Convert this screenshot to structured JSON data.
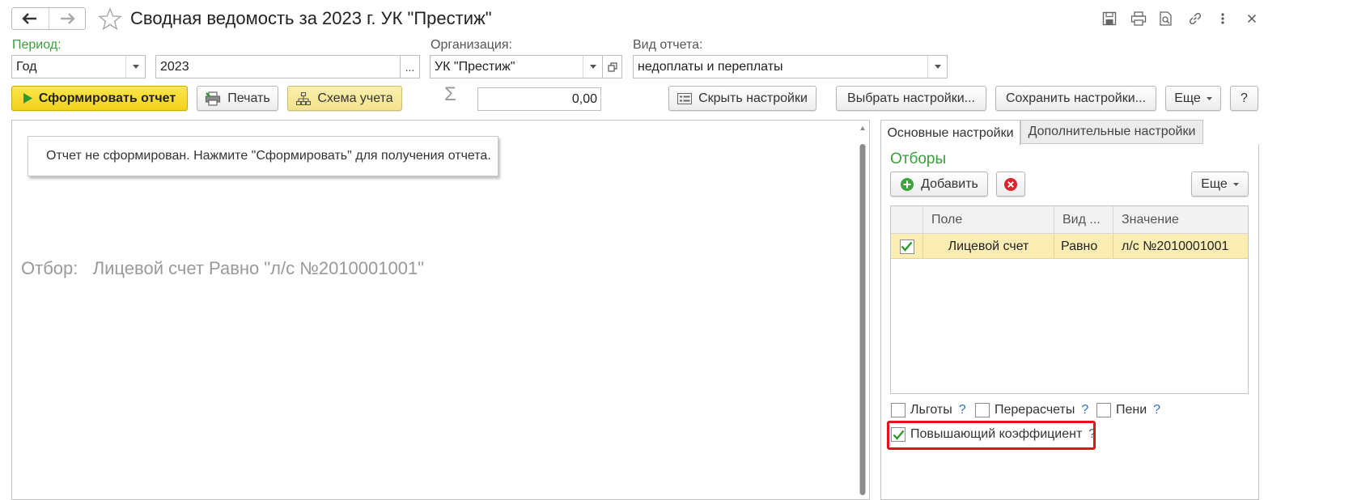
{
  "window": {
    "title": "Сводная ведомость за 2023 г. УК \"Престиж\""
  },
  "period": {
    "label": "Период:",
    "type_value": "Год",
    "year_value": "2023",
    "ellipsis": "..."
  },
  "organization": {
    "label": "Организация:",
    "value": "УК \"Престиж\""
  },
  "report_type": {
    "label": "Вид отчета:",
    "value": "недоплаты и переплаты"
  },
  "toolbar": {
    "generate_label": "Сформировать отчет",
    "print_label": "Печать",
    "scheme_label": "Схема учета",
    "sum_symbol": "Σ",
    "sum_value": "0,00",
    "hide_settings_label": "Скрыть настройки",
    "choose_settings_label": "Выбрать настройки...",
    "save_settings_label": "Сохранить настройки...",
    "more_label": "Еще",
    "help_label": "?"
  },
  "report": {
    "message": "Отчет не сформирован. Нажмите \"Сформировать\" для получения отчета.",
    "filter_text": "Отбор:   Лицевой счет Равно \"л/с №2010001001\""
  },
  "settings": {
    "tabs": [
      "Основные настройки",
      "Дополнительные настройки"
    ],
    "section_title": "Отборы",
    "add_label": "Добавить",
    "more_label": "Еще",
    "columns": [
      "Поле",
      "Вид ...",
      "Значение"
    ],
    "rows": [
      {
        "checked": true,
        "field": "Лицевой счет",
        "kind": "Равно",
        "value": "л/с №2010001001"
      }
    ],
    "options": [
      {
        "label": "Льготы",
        "checked": false,
        "help": "?"
      },
      {
        "label": "Перерасчеты",
        "checked": false,
        "help": "?"
      },
      {
        "label": "Пени",
        "checked": false,
        "help": "?"
      },
      {
        "label": "Повышающий коэффициент",
        "checked": true,
        "help": "?"
      }
    ]
  },
  "colors": {
    "accent_green": "#3a9e3a",
    "primary_yellow": "#f2d31c",
    "highlight_red": "#e2141b",
    "selected_row": "#fbeeb5"
  }
}
